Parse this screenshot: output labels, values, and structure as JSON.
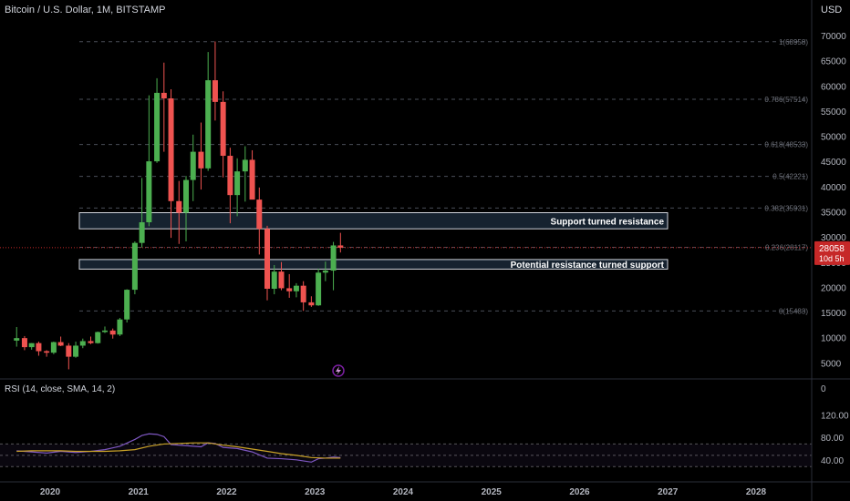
{
  "header": {
    "title": "Bitcoin / U.S. Dollar, 1M, BITSTAMP",
    "currency": "USD"
  },
  "price_label": {
    "value": "28058",
    "countdown": "10d 5h"
  },
  "rsi_header": "RSI (14, close, SMA, 14, 2)",
  "colors": {
    "up": "#26a69a",
    "up_fill": "#4caf50",
    "down": "#ef5350",
    "down_fill": "#c62828",
    "rsi": "#7e57c2",
    "rsi_ma": "#c9a227",
    "zone": "#16222f",
    "price_tag": "#c62828"
  },
  "chart_data": [
    {
      "type": "candlestick",
      "title": "Bitcoin / U.S. Dollar, 1M, BITSTAMP",
      "ylim": [
        0,
        70000
      ],
      "yticks": [
        0,
        5000,
        10000,
        15000,
        20000,
        25000,
        30000,
        35000,
        40000,
        45000,
        50000,
        55000,
        60000,
        65000,
        70000
      ],
      "xlim": [
        2019.6,
        2028.6
      ],
      "xticks": [
        "2020",
        "2021",
        "2022",
        "2023",
        "2024",
        "2025",
        "2026",
        "2027",
        "2028"
      ],
      "candles": [
        {
          "t": 2019.62,
          "o": 9600,
          "h": 12300,
          "l": 8400,
          "c": 10100
        },
        {
          "t": 2019.71,
          "o": 10100,
          "h": 10500,
          "l": 7700,
          "c": 8300
        },
        {
          "t": 2019.79,
          "o": 8300,
          "h": 9100,
          "l": 7800,
          "c": 9100
        },
        {
          "t": 2019.87,
          "o": 9100,
          "h": 9400,
          "l": 6600,
          "c": 7500
        },
        {
          "t": 2019.96,
          "o": 7500,
          "h": 7700,
          "l": 6400,
          "c": 7200
        },
        {
          "t": 2020.04,
          "o": 7200,
          "h": 9400,
          "l": 6900,
          "c": 9300
        },
        {
          "t": 2020.12,
          "o": 9300,
          "h": 10400,
          "l": 8500,
          "c": 8600
        },
        {
          "t": 2020.21,
          "o": 8600,
          "h": 9100,
          "l": 3900,
          "c": 6400
        },
        {
          "t": 2020.29,
          "o": 6400,
          "h": 9400,
          "l": 6200,
          "c": 8600
        },
        {
          "t": 2020.37,
          "o": 8600,
          "h": 10000,
          "l": 8100,
          "c": 9500
        },
        {
          "t": 2020.46,
          "o": 9500,
          "h": 10400,
          "l": 8900,
          "c": 9100
        },
        {
          "t": 2020.54,
          "o": 9100,
          "h": 11400,
          "l": 9000,
          "c": 11300
        },
        {
          "t": 2020.62,
          "o": 11300,
          "h": 12400,
          "l": 11100,
          "c": 11600
        },
        {
          "t": 2020.71,
          "o": 11600,
          "h": 12000,
          "l": 10000,
          "c": 10800
        },
        {
          "t": 2020.79,
          "o": 10800,
          "h": 14100,
          "l": 10500,
          "c": 13800
        },
        {
          "t": 2020.87,
          "o": 13800,
          "h": 19800,
          "l": 13200,
          "c": 19700
        },
        {
          "t": 2020.96,
          "o": 19700,
          "h": 29300,
          "l": 18800,
          "c": 29000
        },
        {
          "t": 2021.04,
          "o": 29000,
          "h": 41900,
          "l": 28100,
          "c": 33100
        },
        {
          "t": 2021.12,
          "o": 33100,
          "h": 58300,
          "l": 32300,
          "c": 45200
        },
        {
          "t": 2021.21,
          "o": 45200,
          "h": 61700,
          "l": 44900,
          "c": 58800
        },
        {
          "t": 2021.29,
          "o": 58800,
          "h": 64800,
          "l": 47100,
          "c": 57700
        },
        {
          "t": 2021.37,
          "o": 57700,
          "h": 59500,
          "l": 30000,
          "c": 37300
        },
        {
          "t": 2021.46,
          "o": 37300,
          "h": 41300,
          "l": 28800,
          "c": 35000
        },
        {
          "t": 2021.54,
          "o": 35000,
          "h": 42300,
          "l": 29300,
          "c": 41500
        },
        {
          "t": 2021.62,
          "o": 41500,
          "h": 50500,
          "l": 37300,
          "c": 47100
        },
        {
          "t": 2021.71,
          "o": 47100,
          "h": 52900,
          "l": 39600,
          "c": 43800
        },
        {
          "t": 2021.79,
          "o": 43800,
          "h": 66900,
          "l": 43300,
          "c": 61300
        },
        {
          "t": 2021.87,
          "o": 61300,
          "h": 69000,
          "l": 53300,
          "c": 57000
        },
        {
          "t": 2021.96,
          "o": 57000,
          "h": 59100,
          "l": 42000,
          "c": 46300
        },
        {
          "t": 2022.04,
          "o": 46300,
          "h": 47900,
          "l": 32900,
          "c": 38500
        },
        {
          "t": 2022.12,
          "o": 38500,
          "h": 45800,
          "l": 34300,
          "c": 43200
        },
        {
          "t": 2022.21,
          "o": 43200,
          "h": 48200,
          "l": 37200,
          "c": 45500
        },
        {
          "t": 2022.29,
          "o": 45500,
          "h": 47400,
          "l": 37700,
          "c": 37600
        },
        {
          "t": 2022.37,
          "o": 37600,
          "h": 40000,
          "l": 26700,
          "c": 31800
        },
        {
          "t": 2022.46,
          "o": 31800,
          "h": 32400,
          "l": 17600,
          "c": 19900
        },
        {
          "t": 2022.54,
          "o": 19900,
          "h": 24600,
          "l": 18800,
          "c": 23300
        },
        {
          "t": 2022.62,
          "o": 23300,
          "h": 25200,
          "l": 19600,
          "c": 20000
        },
        {
          "t": 2022.71,
          "o": 20000,
          "h": 22800,
          "l": 18100,
          "c": 19400
        },
        {
          "t": 2022.79,
          "o": 19400,
          "h": 21000,
          "l": 18200,
          "c": 20500
        },
        {
          "t": 2022.87,
          "o": 20500,
          "h": 21400,
          "l": 15500,
          "c": 17200
        },
        {
          "t": 2022.96,
          "o": 17200,
          "h": 18400,
          "l": 16300,
          "c": 16600
        },
        {
          "t": 2023.04,
          "o": 16600,
          "h": 23900,
          "l": 16500,
          "c": 23100
        },
        {
          "t": 2023.12,
          "o": 23100,
          "h": 25300,
          "l": 21400,
          "c": 23500
        },
        {
          "t": 2023.21,
          "o": 23500,
          "h": 29200,
          "l": 19600,
          "c": 28500
        },
        {
          "t": 2023.29,
          "o": 28500,
          "h": 31000,
          "l": 27100,
          "c": 28058
        }
      ],
      "fib_levels": [
        {
          "label": "1(68958)",
          "value": 68958
        },
        {
          "label": "0.786(57514)",
          "value": 57514
        },
        {
          "label": "0.618(48533)",
          "value": 48533
        },
        {
          "label": "0.5(42221)",
          "value": 42221
        },
        {
          "label": "0.382(35931)",
          "value": 35931
        },
        {
          "label": "0.236(28117)",
          "value": 28117
        },
        {
          "label": "0(15483)",
          "value": 15483
        }
      ],
      "zones": [
        {
          "label": "Support turned resistance",
          "low": 31800,
          "high": 35000
        },
        {
          "label": "Potential resistance turned support",
          "low": 23800,
          "high": 25700
        }
      ],
      "last_price": 28058
    },
    {
      "type": "line",
      "title": "RSI (14, close, SMA, 14, 2)",
      "ylim": [
        24,
        127
      ],
      "yticks": [
        40,
        80,
        120
      ],
      "ytick_labels": [
        "40.00",
        "80.00",
        "120.00"
      ],
      "bands": [
        30,
        50,
        70
      ],
      "series": [
        {
          "key": "rsi",
          "x": [
            2019.62,
            2019.79,
            2019.96,
            2020.12,
            2020.29,
            2020.46,
            2020.62,
            2020.79,
            2020.96,
            2021.04,
            2021.12,
            2021.21,
            2021.29,
            2021.37,
            2021.54,
            2021.71,
            2021.79,
            2021.87,
            2021.96,
            2022.12,
            2022.29,
            2022.46,
            2022.62,
            2022.79,
            2022.96,
            2023.04,
            2023.12,
            2023.21,
            2023.29
          ],
          "values": [
            58,
            56,
            54,
            57,
            55,
            57,
            60,
            66,
            78,
            85,
            88,
            87,
            83,
            69,
            67,
            65,
            72,
            71,
            64,
            62,
            56,
            45,
            44,
            42,
            38,
            44,
            45,
            47,
            46
          ]
        },
        {
          "key": "rsi_ma",
          "x": [
            2019.62,
            2019.79,
            2019.96,
            2020.12,
            2020.29,
            2020.46,
            2020.62,
            2020.79,
            2020.96,
            2021.12,
            2021.29,
            2021.46,
            2021.62,
            2021.79,
            2021.96,
            2022.12,
            2022.29,
            2022.46,
            2022.62,
            2022.79,
            2022.96,
            2023.12,
            2023.29
          ],
          "values": [
            57,
            58,
            58,
            58,
            57,
            57,
            57,
            58,
            60,
            66,
            70,
            71,
            72,
            72,
            68,
            65,
            61,
            57,
            53,
            50,
            46,
            45,
            45
          ]
        }
      ]
    }
  ]
}
